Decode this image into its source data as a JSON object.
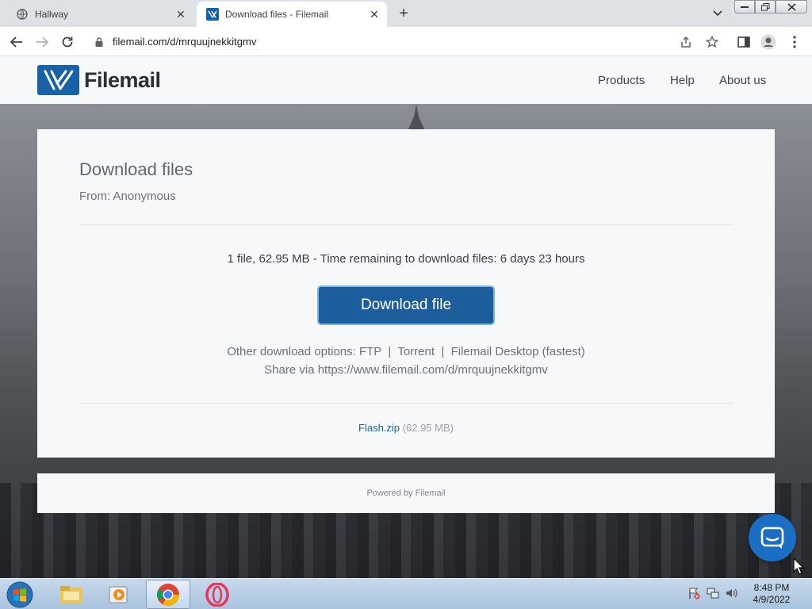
{
  "browser": {
    "tabs": [
      {
        "title": "Hallway",
        "active": false
      },
      {
        "title": "Download files - Filemail",
        "active": true
      }
    ],
    "url": "filemail.com/d/mrquujnekkitgmv"
  },
  "site": {
    "brand": "Filemail",
    "nav": [
      "Products",
      "Help",
      "About us"
    ]
  },
  "download": {
    "heading": "Download files",
    "from": "From: Anonymous",
    "summary": "1 file, 62.95 MB - Time remaining to download files: 6 days 23 hours",
    "button_label": "Download file",
    "other_options": "Other download options: FTP  |  Torrent  |  Filemail Desktop (fastest)",
    "share": "Share via https://www.filemail.com/d/mrquujnekkitgmv",
    "file_name": "Flash.zip",
    "file_size": "(62.95 MB)"
  },
  "footer": {
    "text": "Powered by Filemail"
  },
  "taskbar": {
    "time": "8:48 PM",
    "date": "4/9/2022",
    "apps": [
      "explorer-icon",
      "media-player-icon",
      "chrome-icon",
      "opera-icon"
    ]
  },
  "colors": {
    "brand_blue": "#1762a7",
    "button_blue": "#1c5d9c",
    "chat_blue": "#1a6fc4"
  }
}
